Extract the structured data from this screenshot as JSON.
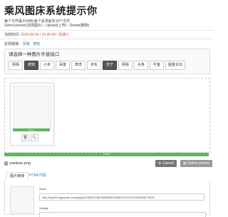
{
  "header": {
    "title": "乘风图床系统提示你",
    "line1": "每个文件最大5MB.每个请求最多10个文件",
    "line2": "Select picture(选择图片) - Upload(上传) - Delete(删除)",
    "time_label": "当前时间:",
    "time_value": "2020-06-06 / 16:45:49 / 星期六"
  },
  "friend_links": {
    "label": "友情链接:",
    "links": [
      "百度",
      "搜狗"
    ]
  },
  "host_picker": {
    "title": "请选择一种图片外链接口",
    "options": [
      "网易",
      "搜狗",
      "小米",
      "百度",
      "奇虎",
      "京东",
      "苏宁",
      "网易",
      "头条",
      "牛客",
      "掘金论坛"
    ],
    "active": [
      1,
      6
    ]
  },
  "preview": {
    "done_text": "Done"
  },
  "upload": {
    "file_name": "xiaobao.png",
    "progress_text": "Done",
    "progress": 1.0,
    "cancel_label": "Cancel",
    "select_label": "Select picture"
  },
  "tabs": [
    "图片链接",
    "HTML代码"
  ],
  "result": {
    "label1": "Sourl:",
    "url": "http://img03.sogoucdn.com/app/a/100520146/26625B0D3A8DFEC920C21D3800F70095",
    "label2": "Sulong"
  },
  "colors": {
    "accent_red": "#d9534f",
    "link_blue": "#337ab7",
    "success_green": "#5cb85c"
  }
}
